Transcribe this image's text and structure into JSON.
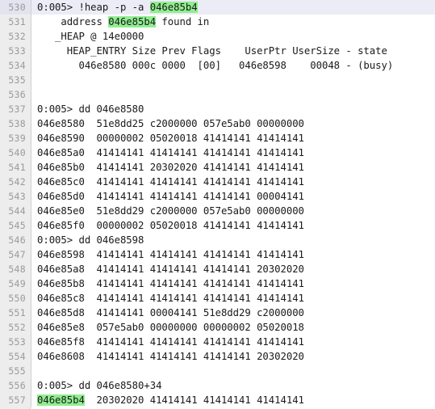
{
  "viewer": {
    "name": "debugger-transcript",
    "first_line_number": 530,
    "active_line_number": 530,
    "highlight_token": "046e85b4",
    "colors": {
      "highlight_green": "#90ee90",
      "active_line": "#ececf7",
      "gutter_background": "#ededed",
      "gutter_text": "#9a9a9a",
      "text": "#1a1a1a",
      "page_background": "#ffffff"
    }
  },
  "lines": [
    {
      "num": "530",
      "active": true,
      "segments": [
        {
          "t": "0:005> !heap -p -a ",
          "hl": false
        },
        {
          "t": "046e85b4",
          "hl": true
        }
      ]
    },
    {
      "num": "531",
      "active": false,
      "segments": [
        {
          "t": "    address ",
          "hl": false
        },
        {
          "t": "046e85b4",
          "hl": true
        },
        {
          "t": " found in",
          "hl": false
        }
      ]
    },
    {
      "num": "532",
      "active": false,
      "segments": [
        {
          "t": "   _HEAP @ 14e0000",
          "hl": false
        }
      ]
    },
    {
      "num": "533",
      "active": false,
      "segments": [
        {
          "t": "     HEAP_ENTRY Size Prev Flags    UserPtr UserSize - state",
          "hl": false
        }
      ]
    },
    {
      "num": "534",
      "active": false,
      "segments": [
        {
          "t": "       046e8580 000c 0000  [00]   046e8598    00048 - (busy)",
          "hl": false
        }
      ]
    },
    {
      "num": "535",
      "active": false,
      "segments": [
        {
          "t": "",
          "hl": false
        }
      ]
    },
    {
      "num": "536",
      "active": false,
      "segments": [
        {
          "t": "",
          "hl": false
        }
      ]
    },
    {
      "num": "537",
      "active": false,
      "segments": [
        {
          "t": "0:005> dd 046e8580",
          "hl": false
        }
      ]
    },
    {
      "num": "538",
      "active": false,
      "segments": [
        {
          "t": "046e8580  51e8dd25 c2000000 057e5ab0 00000000",
          "hl": false
        }
      ]
    },
    {
      "num": "539",
      "active": false,
      "segments": [
        {
          "t": "046e8590  00000002 05020018 41414141 41414141",
          "hl": false
        }
      ]
    },
    {
      "num": "540",
      "active": false,
      "segments": [
        {
          "t": "046e85a0  41414141 41414141 41414141 41414141",
          "hl": false
        }
      ]
    },
    {
      "num": "541",
      "active": false,
      "segments": [
        {
          "t": "046e85b0  41414141 20302020 41414141 41414141",
          "hl": false
        }
      ]
    },
    {
      "num": "542",
      "active": false,
      "segments": [
        {
          "t": "046e85c0  41414141 41414141 41414141 41414141",
          "hl": false
        }
      ]
    },
    {
      "num": "543",
      "active": false,
      "segments": [
        {
          "t": "046e85d0  41414141 41414141 41414141 00004141",
          "hl": false
        }
      ]
    },
    {
      "num": "544",
      "active": false,
      "segments": [
        {
          "t": "046e85e0  51e8dd29 c2000000 057e5ab0 00000000",
          "hl": false
        }
      ]
    },
    {
      "num": "545",
      "active": false,
      "segments": [
        {
          "t": "046e85f0  00000002 05020018 41414141 41414141",
          "hl": false
        }
      ]
    },
    {
      "num": "546",
      "active": false,
      "segments": [
        {
          "t": "0:005> dd 046e8598",
          "hl": false
        }
      ]
    },
    {
      "num": "547",
      "active": false,
      "segments": [
        {
          "t": "046e8598  41414141 41414141 41414141 41414141",
          "hl": false
        }
      ]
    },
    {
      "num": "548",
      "active": false,
      "segments": [
        {
          "t": "046e85a8  41414141 41414141 41414141 20302020",
          "hl": false
        }
      ]
    },
    {
      "num": "549",
      "active": false,
      "segments": [
        {
          "t": "046e85b8  41414141 41414141 41414141 41414141",
          "hl": false
        }
      ]
    },
    {
      "num": "550",
      "active": false,
      "segments": [
        {
          "t": "046e85c8  41414141 41414141 41414141 41414141",
          "hl": false
        }
      ]
    },
    {
      "num": "551",
      "active": false,
      "segments": [
        {
          "t": "046e85d8  41414141 00004141 51e8dd29 c2000000",
          "hl": false
        }
      ]
    },
    {
      "num": "552",
      "active": false,
      "segments": [
        {
          "t": "046e85e8  057e5ab0 00000000 00000002 05020018",
          "hl": false
        }
      ]
    },
    {
      "num": "553",
      "active": false,
      "segments": [
        {
          "t": "046e85f8  41414141 41414141 41414141 41414141",
          "hl": false
        }
      ]
    },
    {
      "num": "554",
      "active": false,
      "segments": [
        {
          "t": "046e8608  41414141 41414141 41414141 20302020",
          "hl": false
        }
      ]
    },
    {
      "num": "555",
      "active": false,
      "segments": [
        {
          "t": "",
          "hl": false
        }
      ]
    },
    {
      "num": "556",
      "active": false,
      "segments": [
        {
          "t": "0:005> dd 046e8580+34",
          "hl": false
        }
      ]
    },
    {
      "num": "557",
      "active": false,
      "segments": [
        {
          "t": "046e85b4",
          "hl": true
        },
        {
          "t": "  20302020 41414141 41414141 41414141",
          "hl": false
        }
      ]
    }
  ]
}
